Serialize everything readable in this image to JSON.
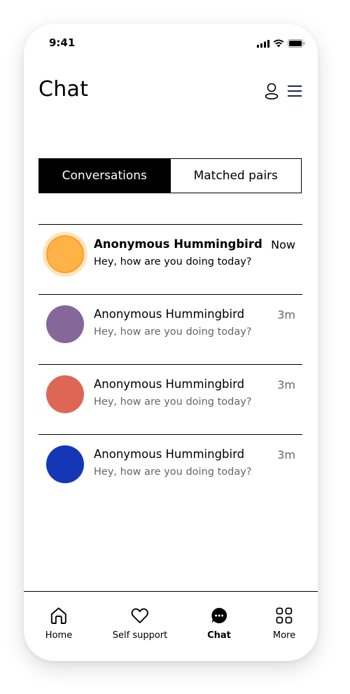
{
  "status_bar": {
    "time": "9:41"
  },
  "header": {
    "title": "Chat"
  },
  "tabs": [
    {
      "label": "Conversations",
      "active": true
    },
    {
      "label": "Matched pairs",
      "active": false
    }
  ],
  "conversations": [
    {
      "name": "Anonymous Hummingbird",
      "preview": "Hey, how are you doing today?",
      "time": "Now",
      "avatar_color": "#FFB347",
      "unread": true
    },
    {
      "name": "Anonymous Hummingbird",
      "preview": "Hey, how are you doing today?",
      "time": "3m",
      "avatar_color": "#86679A",
      "unread": false
    },
    {
      "name": "Anonymous Hummingbird",
      "preview": "Hey, how are you doing today?",
      "time": "3m",
      "avatar_color": "#DD6754",
      "unread": false
    },
    {
      "name": "Anonymous Hummingbird",
      "preview": "Hey, how are you doing today?",
      "time": "3m",
      "avatar_color": "#1437B6",
      "unread": false
    }
  ],
  "bottom_nav": [
    {
      "label": "Home",
      "icon": "home-icon",
      "active": false
    },
    {
      "label": "Self support",
      "icon": "heart-icon",
      "active": false
    },
    {
      "label": "Chat",
      "icon": "chat-bubble-icon",
      "active": true
    },
    {
      "label": "More",
      "icon": "grid-icon",
      "active": false
    }
  ],
  "colors": {
    "accent": "#000000",
    "highlight_ring": "#F6A12A"
  }
}
